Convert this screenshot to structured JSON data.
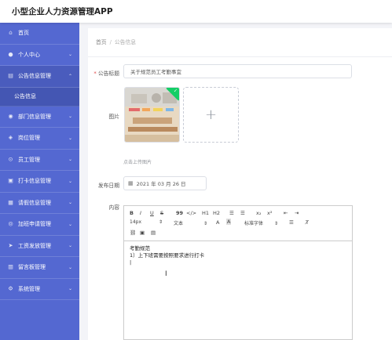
{
  "app": {
    "title": "小型企业人力资源管理APP"
  },
  "sidebar": {
    "items": [
      {
        "label": "首页",
        "icon": "home-icon",
        "has_arrow": false
      },
      {
        "label": "个人中心",
        "icon": "person-icon",
        "has_arrow": true
      },
      {
        "label": "公告信息管理",
        "icon": "notice-icon",
        "has_arrow": true,
        "expanded": true
      },
      {
        "label": "部门信息管理",
        "icon": "department-icon",
        "has_arrow": true
      },
      {
        "label": "岗位管理",
        "icon": "position-icon",
        "has_arrow": true
      },
      {
        "label": "员工管理",
        "icon": "employee-icon",
        "has_arrow": true
      },
      {
        "label": "打卡信息管理",
        "icon": "clock-icon",
        "has_arrow": true
      },
      {
        "label": "请假信息管理",
        "icon": "leave-icon",
        "has_arrow": true
      },
      {
        "label": "加班申请管理",
        "icon": "overtime-icon",
        "has_arrow": true
      },
      {
        "label": "工资发放管理",
        "icon": "salary-icon",
        "has_arrow": true
      },
      {
        "label": "留言板管理",
        "icon": "message-icon",
        "has_arrow": true
      },
      {
        "label": "系统管理",
        "icon": "settings-icon",
        "has_arrow": true
      }
    ],
    "subitem": "公告信息"
  },
  "breadcrumb": {
    "home": "首页",
    "separator": "/",
    "current": "公告信息"
  },
  "form": {
    "title_label": "公告标题",
    "title_value": "关于规范员工考勤事宜",
    "image_label": "图片",
    "upload_hint": "点击上传图片",
    "date_label": "发布日期",
    "date_value": "2021 年 03 月 26 日",
    "content_label": "内容"
  },
  "editor": {
    "toolbar_row1": [
      "B",
      "I",
      "U",
      "S",
      "99",
      "</>",
      "H1",
      "H2",
      "☰",
      "☰",
      "x₂",
      "x²",
      "⇤",
      "⇥"
    ],
    "font_size": "14px",
    "text_type": "文本",
    "font_family": "标准字体",
    "content_lines": [
      "考勤规范",
      "1）上下班需要按照要求进行打卡"
    ]
  },
  "colors": {
    "sidebar": "#5468d1",
    "accent": "#13ce66"
  }
}
